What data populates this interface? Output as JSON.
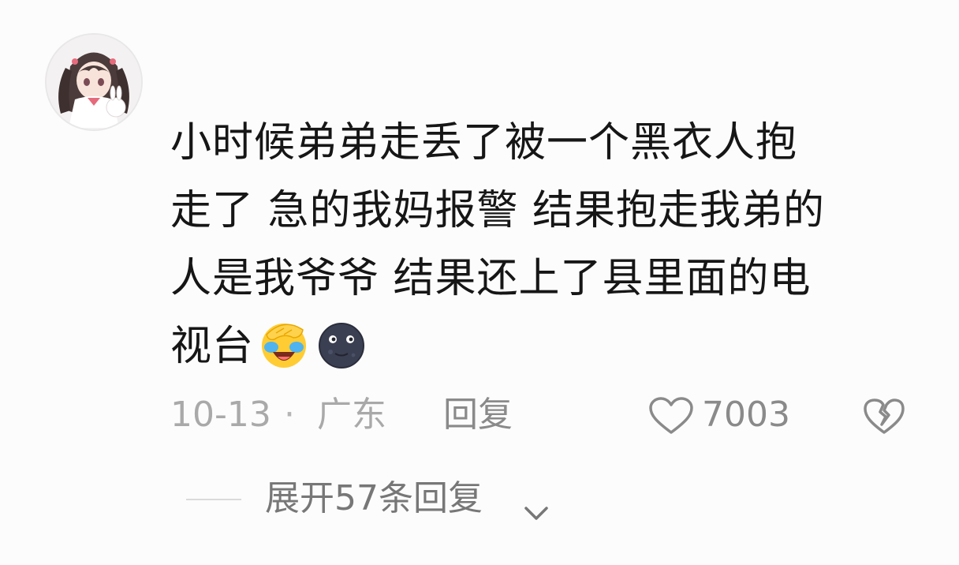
{
  "comment": {
    "author_avatar": "anime-girl-avatar",
    "lines": [
      "小时候弟弟走丢了被一个黑衣人抱",
      "走了 急的我妈报警 结果抱走我弟的",
      "人是我爷爷 结果还上了县里面的电",
      "视台"
    ],
    "emojis": [
      "facepalm-crying-laughing-icon",
      "new-moon-face-icon"
    ]
  },
  "meta": {
    "date": "10-13",
    "separator": "·",
    "location": "广东",
    "reply_label": "回复",
    "like_count": "7003"
  },
  "expand": {
    "label": "展开57条回复"
  },
  "colors": {
    "text_primary": "#161616",
    "text_secondary": "#a9a9a9",
    "background": "#fcfcfc"
  }
}
